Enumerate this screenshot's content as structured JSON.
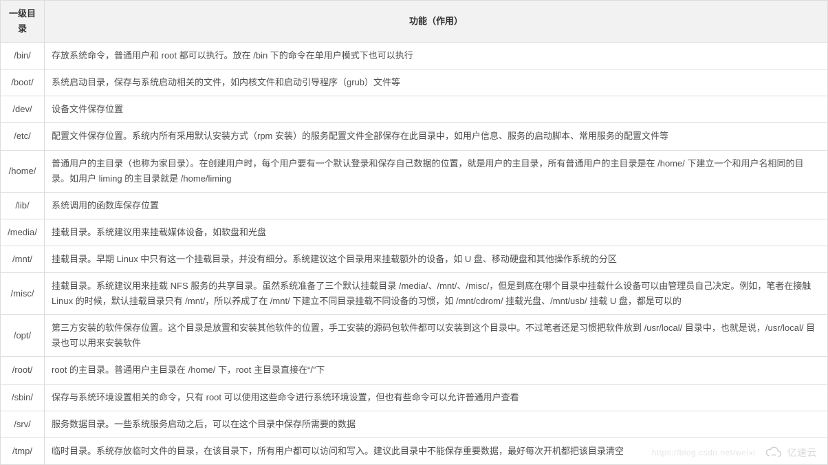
{
  "table": {
    "headers": {
      "directory": "一级目录",
      "function": "功能（作用）"
    },
    "rows": [
      {
        "dir": "/bin/",
        "desc": "存放系统命令，普通用户和 root 都可以执行。放在 /bin 下的命令在单用户模式下也可以执行"
      },
      {
        "dir": "/boot/",
        "desc": "系统启动目录，保存与系统启动相关的文件，如内核文件和启动引导程序（grub）文件等"
      },
      {
        "dir": "/dev/",
        "desc": "设备文件保存位置"
      },
      {
        "dir": "/etc/",
        "desc": "配置文件保存位置。系统内所有采用默认安装方式（rpm 安装）的服务配置文件全部保存在此目录中，如用户信息、服务的启动脚本、常用服务的配置文件等"
      },
      {
        "dir": "/home/",
        "desc": "普通用户的主目录（也称为家目录）。在创建用户时，每个用户要有一个默认登录和保存自己数据的位置，就是用户的主目录，所有普通用户的主目录是在 /home/ 下建立一个和用户名相同的目录。如用户 liming 的主目录就是 /home/liming"
      },
      {
        "dir": "/lib/",
        "desc": "系统调用的函数库保存位置"
      },
      {
        "dir": "/media/",
        "desc": "挂载目录。系统建议用来挂载媒体设备，如软盘和光盘"
      },
      {
        "dir": "/mnt/",
        "desc": "挂载目录。早期 Linux 中只有这一个挂载目录，并没有细分。系统建议这个目录用来挂载额外的设备，如 U 盘、移动硬盘和其他操作系统的分区"
      },
      {
        "dir": "/misc/",
        "desc": "挂载目录。系统建议用来挂载 NFS 服务的共享目录。虽然系统准备了三个默认挂载目录 /media/、/mnt/、/misc/，但是到底在哪个目录中挂载什么设备可以由管理员自己决定。例如，笔者在接触 Linux 的时候，默认挂载目录只有 /mnt/，所以养成了在 /mnt/ 下建立不同目录挂载不同设备的习惯，如 /mnt/cdrom/ 挂载光盘、/mnt/usb/ 挂载 U 盘，都是可以的"
      },
      {
        "dir": "/opt/",
        "desc": "第三方安装的软件保存位置。这个目录是放置和安装其他软件的位置，手工安装的源码包软件都可以安装到这个目录中。不过笔者还是习惯把软件放到 /usr/local/ 目录中，也就是说，/usr/local/ 目录也可以用来安装软件"
      },
      {
        "dir": "/root/",
        "desc": "root 的主目录。普通用户主目录在 /home/ 下，root 主目录直接在“/”下"
      },
      {
        "dir": "/sbin/",
        "desc": "保存与系统环境设置相关的命令，只有 root 可以使用这些命令进行系统环境设置，但也有些命令可以允许普通用户查看"
      },
      {
        "dir": "/srv/",
        "desc": "服务数据目录。一些系统服务启动之后，可以在这个目录中保存所需要的数据"
      },
      {
        "dir": "/tmp/",
        "desc": "临时目录。系统存放临时文件的目录，在该目录下，所有用户都可以访问和写入。建议此目录中不能保存重要数据，最好每次开机都把该目录清空"
      }
    ]
  },
  "watermark": {
    "sub": "https://blog.csdn.net/weixi",
    "brand": "亿速云"
  }
}
